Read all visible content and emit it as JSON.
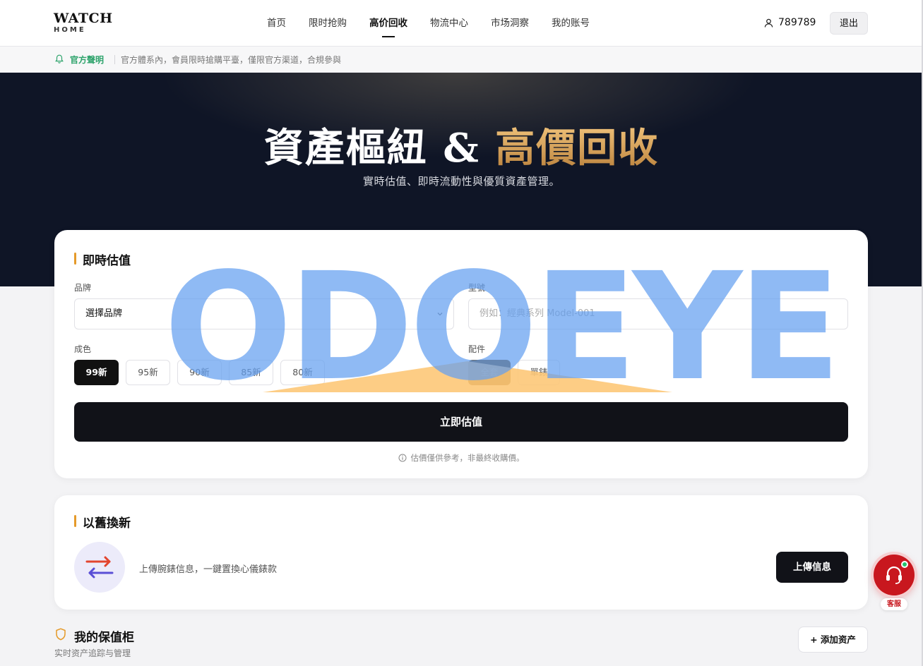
{
  "header": {
    "logo_main": "WATCH",
    "logo_sub": "HOME",
    "nav": [
      "首页",
      "限时抢购",
      "高价回收",
      "物流中心",
      "市场洞察",
      "我的账号"
    ],
    "active_nav": "高价回收",
    "user_id": "789789",
    "logout_label": "退出"
  },
  "notice": {
    "label": "官方聲明",
    "text": "官方體系內，會員限時搶購平臺，僅限官方渠道，合規參與"
  },
  "hero": {
    "title_white": "資產樞紐 & ",
    "title_gold": "高價回收",
    "subtitle": "實時估值、即時流動性與優質資產管理。"
  },
  "valuation": {
    "title": "即時估值",
    "brand_label": "品牌",
    "brand_value": "選擇品牌",
    "model_label": "型號",
    "model_placeholder": "例如：經典系列 Model-001",
    "condition_label": "成色",
    "conditions": [
      "99新",
      "95新",
      "90新",
      "85新",
      "80新"
    ],
    "condition_selected": "99新",
    "accessory_label": "配件",
    "accessories": [
      "全套",
      "單錶"
    ],
    "accessory_selected": "全套",
    "submit_label": "立即估值",
    "hint": "估價僅供參考，非最終收購價。"
  },
  "trade_in": {
    "title": "以舊換新",
    "text": "上傳腕錶信息，一鍵置換心儀錶款",
    "button_label": "上傳信息"
  },
  "vault": {
    "title": "我的保值柜",
    "subtitle": "实时资产追踪与管理",
    "add_label": "+ 添加资产"
  },
  "support": {
    "label": "客服"
  },
  "watermark": {
    "text": "ODOEYE"
  },
  "colors": {
    "accent_gold": "#d9a35a",
    "hero_bg": "#0f1526",
    "notice_green": "#2da36b",
    "support_red": "#c8171e",
    "watermark_blue": "#64a0f0"
  }
}
